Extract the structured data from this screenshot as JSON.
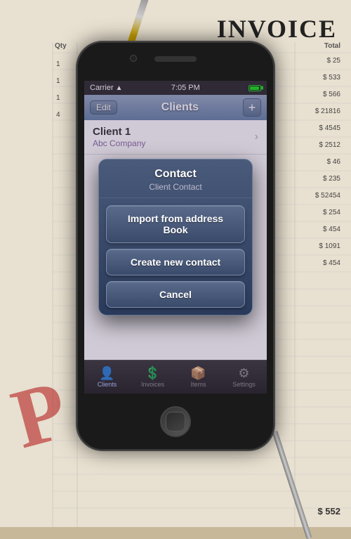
{
  "background": {
    "invoice_title": "INVOICE",
    "qty_label": "Qty",
    "total_label": "Total",
    "amounts": [
      "$ 25",
      "$ 533",
      "$ 566",
      "$ 21816",
      "$ 4545",
      "$ 2512",
      "$ 46",
      "$ 235",
      "$ 52454",
      "$ 254",
      "$ 454",
      "$ 1091",
      "$ 454"
    ],
    "qty_values": [
      "1",
      "1",
      "1",
      "4",
      "",
      "",
      "",
      "",
      "",
      "",
      "",
      "",
      ""
    ],
    "bottom_total": "$ 552",
    "stamp_letter": "P"
  },
  "status_bar": {
    "carrier": "Carrier",
    "time": "7:05 PM"
  },
  "nav_bar": {
    "edit_label": "Edit",
    "title": "Clients",
    "add_label": "+"
  },
  "client": {
    "name": "Client 1",
    "company": "Abc Company"
  },
  "dialog": {
    "title": "Contact",
    "subtitle": "Client Contact",
    "import_btn": "Import from address Book",
    "create_btn": "Create new contact",
    "cancel_btn": "Cancel"
  },
  "tabs": [
    {
      "label": "Clients",
      "icon": "👤",
      "active": true
    },
    {
      "label": "Invoices",
      "icon": "💲",
      "active": false
    },
    {
      "label": "Items",
      "icon": "📦",
      "active": false
    },
    {
      "label": "Settings",
      "icon": "⚙",
      "active": false
    }
  ]
}
